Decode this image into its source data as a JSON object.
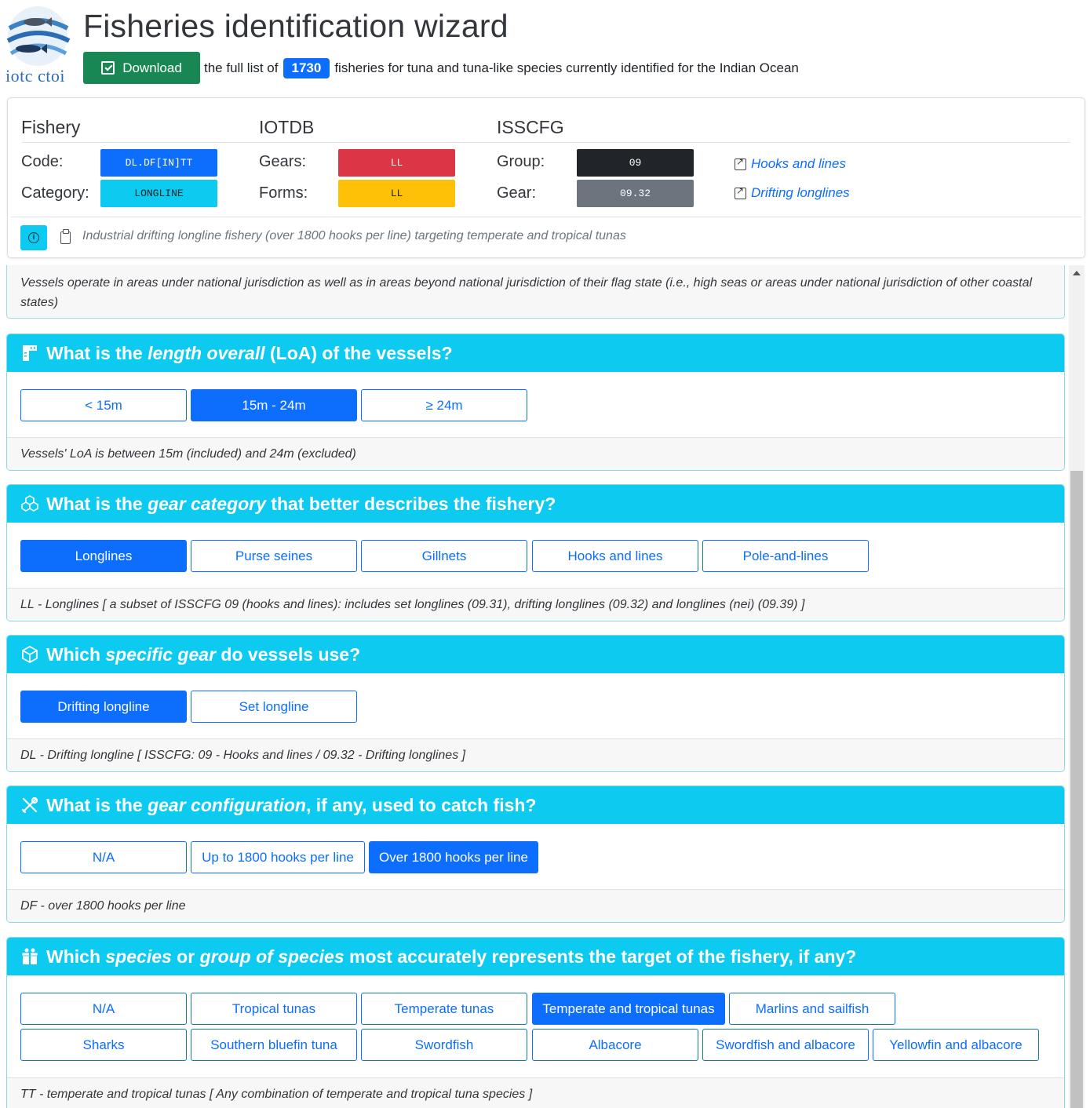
{
  "header": {
    "logo_text": "iotc ctoi",
    "title": "Fisheries identification wizard",
    "download_label": "Download",
    "text_before": "the full list of",
    "fishery_count": "1730",
    "text_after": "fisheries for tuna and tuna-like species currently identified for the Indian Ocean"
  },
  "summary": {
    "fishery_heading": "Fishery",
    "iotdb_heading": "IOTDB",
    "isscfg_heading": "ISSCFG",
    "code_label": "Code:",
    "code_value": "DL.DF[IN]TT",
    "category_label": "Category:",
    "category_value": "LONGLINE",
    "gears_label": "Gears:",
    "gears_value": "LL",
    "forms_label": "Forms:",
    "forms_value": "LL",
    "group_label": "Group:",
    "group_value": "09",
    "gear_label": "Gear:",
    "gear_value": "09.32",
    "group_link": "Hooks and lines",
    "gear_link": "Drifting longlines",
    "description": "Industrial drifting longline fishery (over 1800 hooks per line) targeting temperate and tropical tunas",
    "colors": {
      "code": "#0d6efd",
      "category": "#0dcaf0",
      "gears": "#dc3545",
      "forms": "#ffc107",
      "group": "#212529",
      "gear": "#6c757d"
    }
  },
  "jurisdiction_note": "Vessels operate in areas under national jurisdiction as well as in areas beyond national jurisdiction of their flag state (i.e., high seas or areas under national jurisdiction of other coastal states)",
  "questions": {
    "loa": {
      "icon": "ruler-icon",
      "title_pre": "What is the ",
      "title_em": "length overall",
      "title_post": " (LoA) of the vessels?",
      "options": [
        "< 15m",
        "15m - 24m",
        "≥ 24m"
      ],
      "selected": "15m - 24m",
      "footer": "Vessels' LoA is between 15m (included) and 24m (excluded)"
    },
    "gear_category": {
      "icon": "boxes-icon",
      "title_pre": "What is the ",
      "title_em": "gear category",
      "title_post": " that better describes the fishery?",
      "options": [
        "Longlines",
        "Purse seines",
        "Gillnets",
        "Hooks and lines",
        "Pole-and-lines"
      ],
      "selected": "Longlines",
      "footer": "LL - Longlines [ a subset of ISSCFG 09 (hooks and lines): includes set longlines (09.31), drifting longlines (09.32) and longlines (nei) (09.39) ]"
    },
    "specific_gear": {
      "icon": "box-icon",
      "title_pre": "Which ",
      "title_em": "specific gear",
      "title_post": " do vessels use?",
      "options": [
        "Drifting longline",
        "Set longline"
      ],
      "selected": "Drifting longline",
      "footer": "DL - Drifting longline [ ISSCFG: 09 - Hooks and lines / 09.32 - Drifting longlines ]"
    },
    "gear_config": {
      "icon": "tools-icon",
      "title_pre": "What is the ",
      "title_em": "gear configuration",
      "title_post": ", if any, used to catch fish?",
      "options": [
        "N/A",
        "Up to 1800 hooks per line",
        "Over 1800 hooks per line"
      ],
      "selected": "Over 1800 hooks per line",
      "footer": "DF - over 1800 hooks per line"
    },
    "species": {
      "icon": "gift-icon",
      "title_pre": "Which ",
      "title_em": "species",
      "title_mid": " or ",
      "title_em2": "group of species",
      "title_post": " most accurately represents the target of the fishery, if any?",
      "options": [
        "N/A",
        "Tropical tunas",
        "Temperate tunas",
        "Temperate and tropical tunas",
        "Marlins and sailfish",
        "Sharks",
        "Southern bluefin tuna",
        "Swordfish",
        "Albacore",
        "Swordfish and albacore",
        "Yellowfin and albacore"
      ],
      "selected": "Temperate and tropical tunas",
      "footer": "TT - temperate and tropical tunas [ Any combination of temperate and tropical tuna species ]"
    }
  }
}
